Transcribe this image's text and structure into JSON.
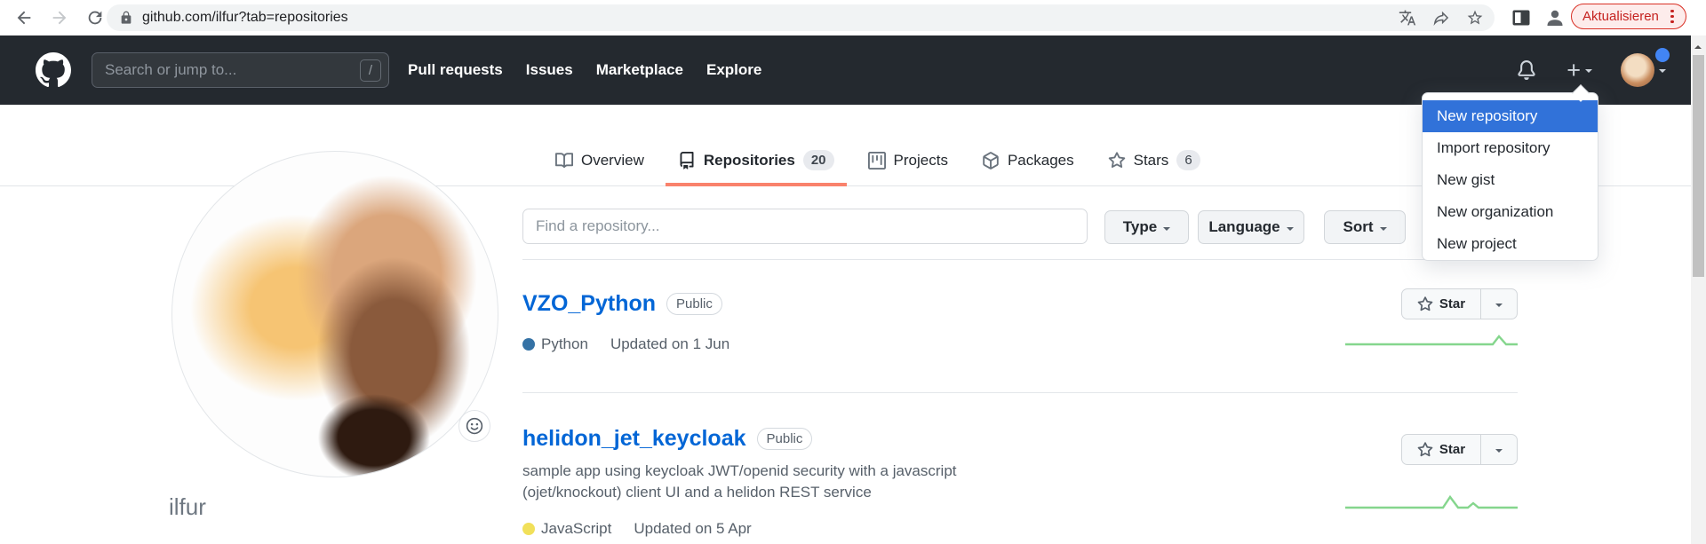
{
  "browser": {
    "url": "github.com/ilfur?tab=repositories",
    "update_button_label": "Aktualisieren"
  },
  "header": {
    "search_placeholder": "Search or jump to...",
    "search_shortcut_key": "/",
    "nav": [
      {
        "label": "Pull requests"
      },
      {
        "label": "Issues"
      },
      {
        "label": "Marketplace"
      },
      {
        "label": "Explore"
      }
    ]
  },
  "dropdown_menu": {
    "items": [
      {
        "label": "New repository",
        "active": true
      },
      {
        "label": "Import repository"
      },
      {
        "label": "New gist"
      },
      {
        "label": "New organization"
      },
      {
        "label": "New project"
      }
    ]
  },
  "profile": {
    "username": "ilfur"
  },
  "tabs": [
    {
      "label": "Overview"
    },
    {
      "label": "Repositories",
      "count": "20",
      "active": true
    },
    {
      "label": "Projects"
    },
    {
      "label": "Packages"
    },
    {
      "label": "Stars",
      "count": "6"
    }
  ],
  "filters": {
    "find_placeholder": "Find a repository...",
    "type_label": "Type",
    "language_label": "Language",
    "sort_label": "Sort"
  },
  "repos": [
    {
      "name": "VZO_Python",
      "visibility": "Public",
      "language": "Python",
      "language_color": "#3572a5",
      "updated": "Updated on 1 Jun",
      "star_label": "Star"
    },
    {
      "name": "helidon_jet_keycloak",
      "visibility": "Public",
      "description_line1": "sample app using keycloak JWT/openid security with a javascript",
      "description_line2": "(ojet/knockout) client UI and a helidon REST service",
      "language": "JavaScript",
      "language_color": "#f1e05a",
      "updated": "Updated on 5 Apr",
      "star_label": "Star"
    }
  ],
  "colors": {
    "accent_underline": "#f9826c",
    "link_blue": "#0366d6",
    "dropdown_active_blue": "#3172d9",
    "update_red": "#c5221f",
    "sparkline_green": "#85d68d",
    "header_bg": "#24292f"
  }
}
